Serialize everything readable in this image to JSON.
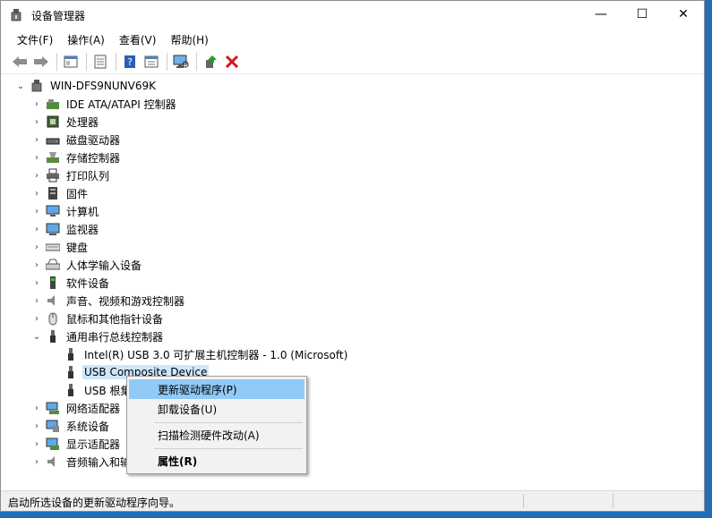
{
  "window": {
    "title": "设备管理器",
    "controls": {
      "minimize": "—",
      "maximize": "☐",
      "close": "✕"
    }
  },
  "menu": [
    "文件(F)",
    "操作(A)",
    "查看(V)",
    "帮助(H)"
  ],
  "toolbar": [
    "back-icon",
    "forward-icon",
    "properties-pane-icon",
    "details-icon",
    "help-icon",
    "view-icon",
    "scan-hardware-icon",
    "update-driver-icon",
    "uninstall-icon"
  ],
  "tree": {
    "root": "WIN-DFS9NUNV69K",
    "categories": [
      {
        "label": "IDE ATA/ATAPI 控制器",
        "icon": "ide-controller-icon"
      },
      {
        "label": "处理器",
        "icon": "processor-icon"
      },
      {
        "label": "磁盘驱动器",
        "icon": "disk-drive-icon"
      },
      {
        "label": "存储控制器",
        "icon": "storage-controller-icon"
      },
      {
        "label": "打印队列",
        "icon": "printer-icon"
      },
      {
        "label": "固件",
        "icon": "firmware-icon"
      },
      {
        "label": "计算机",
        "icon": "computer-icon"
      },
      {
        "label": "监视器",
        "icon": "monitor-icon"
      },
      {
        "label": "键盘",
        "icon": "keyboard-icon"
      },
      {
        "label": "人体学输入设备",
        "icon": "hid-icon"
      },
      {
        "label": "软件设备",
        "icon": "software-device-icon"
      },
      {
        "label": "声音、视频和游戏控制器",
        "icon": "sound-icon"
      },
      {
        "label": "鼠标和其他指针设备",
        "icon": "mouse-icon"
      },
      {
        "label": "通用串行总线控制器",
        "icon": "usb-icon",
        "expanded": true,
        "children": [
          {
            "label": "Intel(R) USB 3.0 可扩展主机控制器 - 1.0 (Microsoft)",
            "icon": "usb-device-icon"
          },
          {
            "label": "USB Composite Device",
            "icon": "usb-device-icon",
            "selected": true
          },
          {
            "label": "USB 根集",
            "icon": "usb-device-icon"
          }
        ]
      },
      {
        "label": "网络适配器",
        "icon": "network-adapter-icon"
      },
      {
        "label": "系统设备",
        "icon": "system-device-icon"
      },
      {
        "label": "显示适配器",
        "icon": "display-adapter-icon"
      },
      {
        "label": "音频输入和输",
        "icon": "audio-io-icon"
      }
    ]
  },
  "context_menu": {
    "items": [
      {
        "label": "更新驱动程序(P)",
        "highlighted": true
      },
      {
        "label": "卸载设备(U)"
      },
      {
        "label": "扫描检测硬件改动(A)"
      },
      {
        "label": "属性(R)",
        "bold": true
      }
    ]
  },
  "status": {
    "text": "启动所选设备的更新驱动程序向导。"
  }
}
